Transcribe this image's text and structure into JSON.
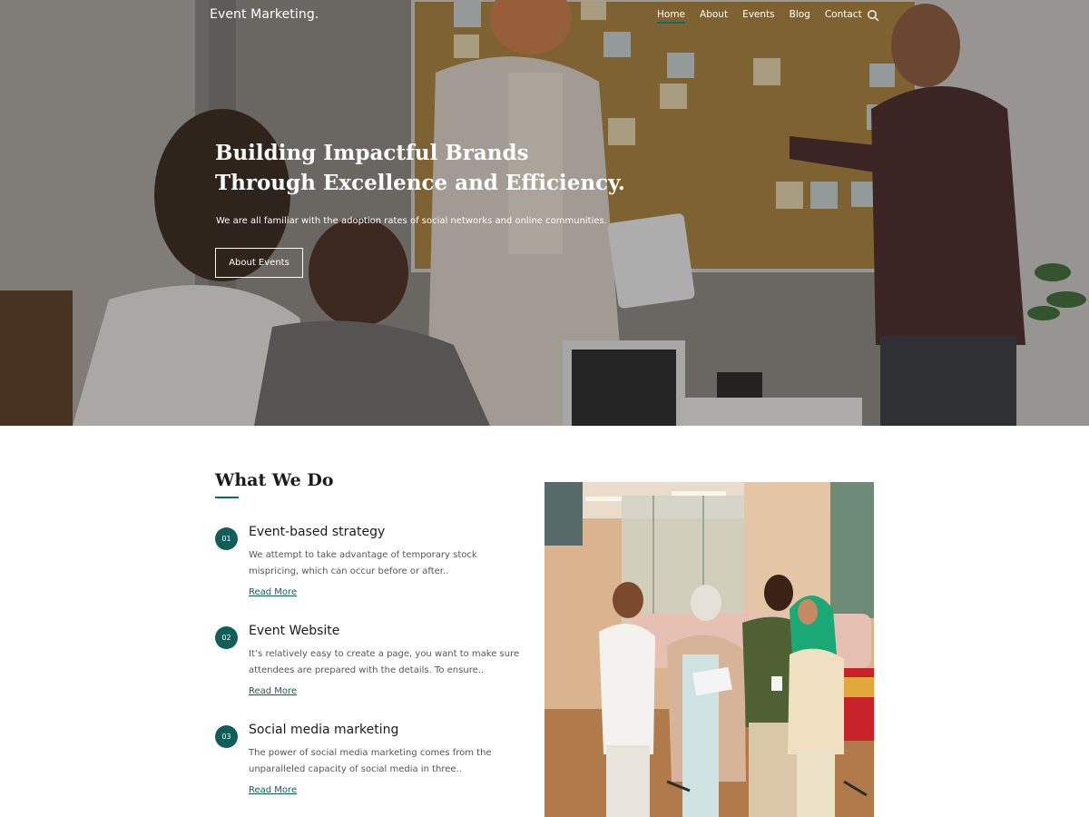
{
  "nav": {
    "logo": "Event Marketing.",
    "items": [
      {
        "label": "Home",
        "active": true
      },
      {
        "label": "About",
        "active": false
      },
      {
        "label": "Events",
        "active": false
      },
      {
        "label": "Blog",
        "active": false
      },
      {
        "label": "Contact",
        "active": false
      }
    ],
    "search_icon": "search-icon"
  },
  "hero": {
    "title": "Building Impactful Brands Through Excellence and Efficiency.",
    "subtitle": "We are all familiar with the adoption rates of social networks and online communities.",
    "button_label": "About Events"
  },
  "what_we_do": {
    "title": "What We Do",
    "services": [
      {
        "number": "01",
        "title": "Event-based strategy",
        "description": "We attempt to take advantage of temporary stock mispricing, which can occur before or after..",
        "link": "Read More"
      },
      {
        "number": "02",
        "title": "Event Website",
        "description": "It’s relatively easy to create a page, you want to make sure attendees are prepared with the details. To ensure..",
        "link": "Read More"
      },
      {
        "number": "03",
        "title": "Social media marketing",
        "description": "The power of social media marketing comes from the unparalleled capacity of social media in three..",
        "link": "Read More"
      }
    ]
  },
  "colors": {
    "accent": "#0f6b66",
    "badge": "#0f5e5a"
  }
}
